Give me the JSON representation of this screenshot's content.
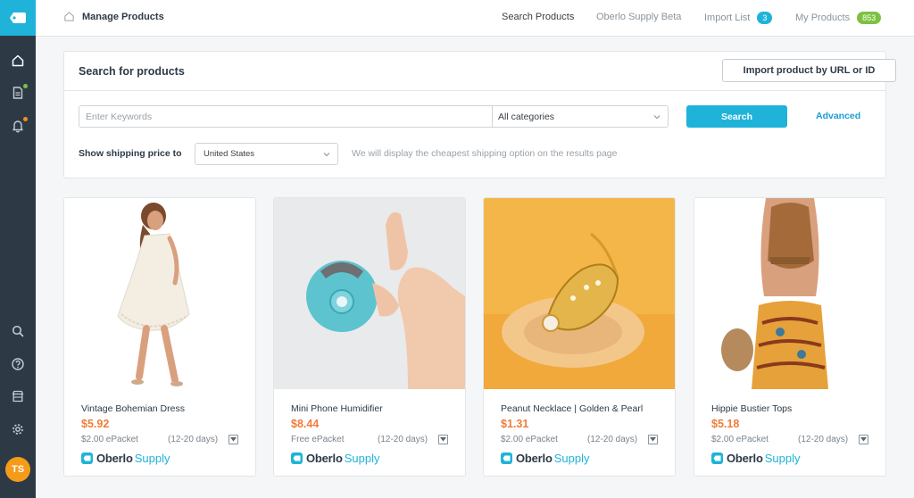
{
  "colors": {
    "accent": "#1fb3d9",
    "sidebar": "#2d3a46",
    "price": "#f27b3a",
    "badge_import": "#1fb3d9",
    "badge_products": "#7cc242",
    "avatar": "#f59b1a"
  },
  "sidebar": {
    "logo_icon": "oberlo-tag-icon",
    "items": [
      {
        "icon": "home-icon"
      },
      {
        "icon": "orders-icon",
        "dot": "#7cc242"
      },
      {
        "icon": "bell-icon",
        "dot": "#f58c1f"
      },
      {
        "icon": "search-icon"
      },
      {
        "icon": "help-icon"
      },
      {
        "icon": "store-icon"
      },
      {
        "icon": "gear-icon"
      }
    ],
    "avatar_initials": "TS"
  },
  "header": {
    "breadcrumb": "Manage Products",
    "nav": [
      {
        "label": "Search Products"
      },
      {
        "label": "Oberlo Supply Beta"
      },
      {
        "label": "Import List",
        "badge": "3"
      },
      {
        "label": "My Products",
        "badge": "853"
      }
    ]
  },
  "search_panel": {
    "title": "Search for products",
    "import_button": "Import product by URL or ID",
    "keyword_placeholder": "Enter Keywords",
    "category_value": "All categories",
    "search_button": "Search",
    "advanced_link": "Advanced",
    "shipping_label": "Show shipping price to",
    "country_value": "United States",
    "shipping_hint": "We will display the cheapest shipping option on the results page"
  },
  "products": [
    {
      "title": "Vintage Bohemian Dress",
      "price": "$5.92",
      "shipping": "$2.00 ePacket",
      "days": "(12-20 days)",
      "brand_a": "Oberlo",
      "brand_b": "Supply"
    },
    {
      "title": "Mini Phone Humidifier",
      "price": "$8.44",
      "shipping": "Free ePacket",
      "days": "(12-20 days)",
      "brand_a": "Oberlo",
      "brand_b": "Supply"
    },
    {
      "title": "Peanut Necklace | Golden & Pearl",
      "price": "$1.31",
      "shipping": "$2.00 ePacket",
      "days": "(12-20 days)",
      "brand_a": "Oberlo",
      "brand_b": "Supply"
    },
    {
      "title": "Hippie Bustier Tops",
      "price": "$5.18",
      "shipping": "$2.00 ePacket",
      "days": "(12-20 days)",
      "brand_a": "Oberlo",
      "brand_b": "Supply"
    }
  ]
}
